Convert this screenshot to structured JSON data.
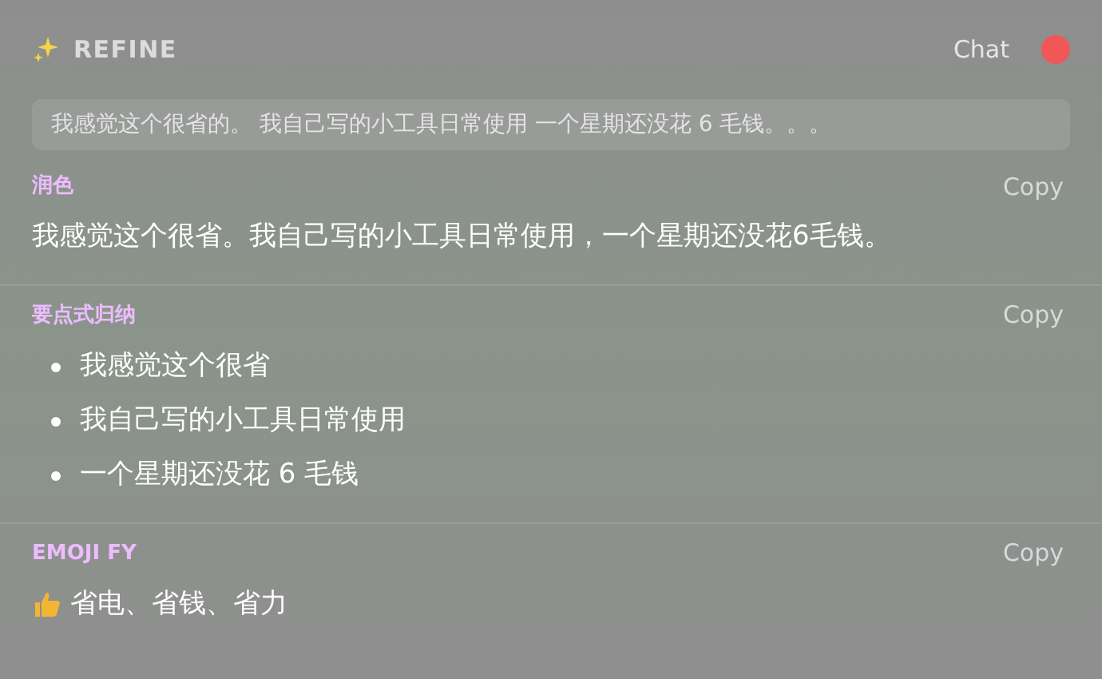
{
  "header": {
    "title": "REFINE",
    "chat_label": "Chat"
  },
  "input": {
    "value": "我感觉这个很省的。 我自己写的小工具日常使用 一个星期还没花 6 毛钱。。。"
  },
  "sections": [
    {
      "kind": "paragraph",
      "label": "润色",
      "copy": "Copy",
      "text": "我感觉这个很省。我自己写的小工具日常使用，一个星期还没花6毛钱。"
    },
    {
      "kind": "bullets",
      "label": "要点式归纳",
      "copy": "Copy",
      "items": [
        "我感觉这个很省",
        "我自己写的小工具日常使用",
        "一个星期还没花 6 毛钱"
      ]
    },
    {
      "kind": "emoji",
      "label": "EMOJI FY",
      "copy": "Copy",
      "text": "省电、省钱、省力"
    }
  ]
}
